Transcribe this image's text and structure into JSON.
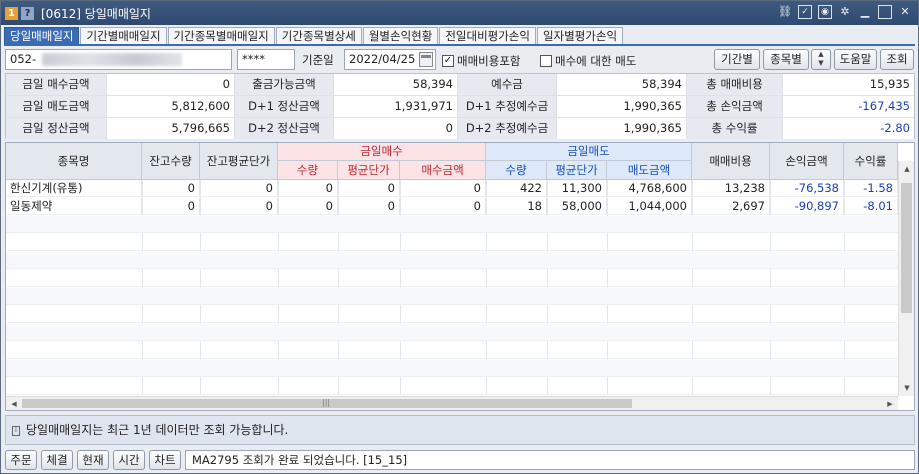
{
  "window": {
    "badge_one": "1",
    "badge_q": "?",
    "title": "[0612] 당일매매일지",
    "controls": [
      "link-icon",
      "check-icon",
      "camera-icon",
      "gear-icon",
      "minimize-icon",
      "maximize-icon",
      "close-icon"
    ]
  },
  "tabs": [
    "당일매매일지",
    "기간별매매일지",
    "기간종목별매매일지",
    "기간종목별상세",
    "월별손익현황",
    "전일대비평가손익",
    "일자별평가손익"
  ],
  "query": {
    "account_prefix": "052-",
    "password": "****",
    "date_label": "기준일",
    "date": "2022/04/25",
    "include_fee_label": "매매비용포함",
    "include_fee_checked": "✓",
    "sell_for_buy_label": "매수에 대한 매도",
    "buttons": {
      "period": "기간별",
      "by_stock": "종목별",
      "help": "도움말",
      "search": "조회"
    }
  },
  "summary": [
    [
      "금일 매수금액",
      "0",
      "출금가능금액",
      "58,394",
      "예수금",
      "58,394",
      "총 매매비용",
      "15,935"
    ],
    [
      "금일 매도금액",
      "5,812,600",
      "D+1 정산금액",
      "1,931,971",
      "D+1 추정예수금",
      "1,990,365",
      "총 손익금액",
      "-167,435"
    ],
    [
      "금일 정산금액",
      "5,796,665",
      "D+2 정산금액",
      "0",
      "D+2 추정예수금",
      "1,990,365",
      "총 수익률",
      "-2.80"
    ]
  ],
  "table": {
    "headers": {
      "name": "종목명",
      "hold_qty": "잔고수량",
      "hold_price": "잔고평균단가",
      "buy_group": "금일매수",
      "sell_group": "금일매도",
      "qty": "수량",
      "avg_price": "평균단가",
      "buy_amt": "매수금액",
      "sell_amt": "매도금액",
      "fee": "매매비용",
      "pnl": "손익금액",
      "rate": "수익률"
    },
    "rows": [
      [
        "한신기계(유통)",
        "0",
        "0",
        "0",
        "0",
        "0",
        "422",
        "11,300",
        "4,768,600",
        "13,238",
        "-76,538",
        "-1.58"
      ],
      [
        "일동제약",
        "0",
        "0",
        "0",
        "0",
        "0",
        "18",
        "58,000",
        "1,044,000",
        "2,697",
        "-90,897",
        "-8.01"
      ]
    ]
  },
  "notice": "당일매매일지는 최근 1년 데이터만 조회 가능합니다.",
  "bottom": {
    "buttons": [
      "주문",
      "체결",
      "현재",
      "시간",
      "차트"
    ],
    "status": "MA2795 조회가 완료 되었습니다. [15_15]"
  }
}
